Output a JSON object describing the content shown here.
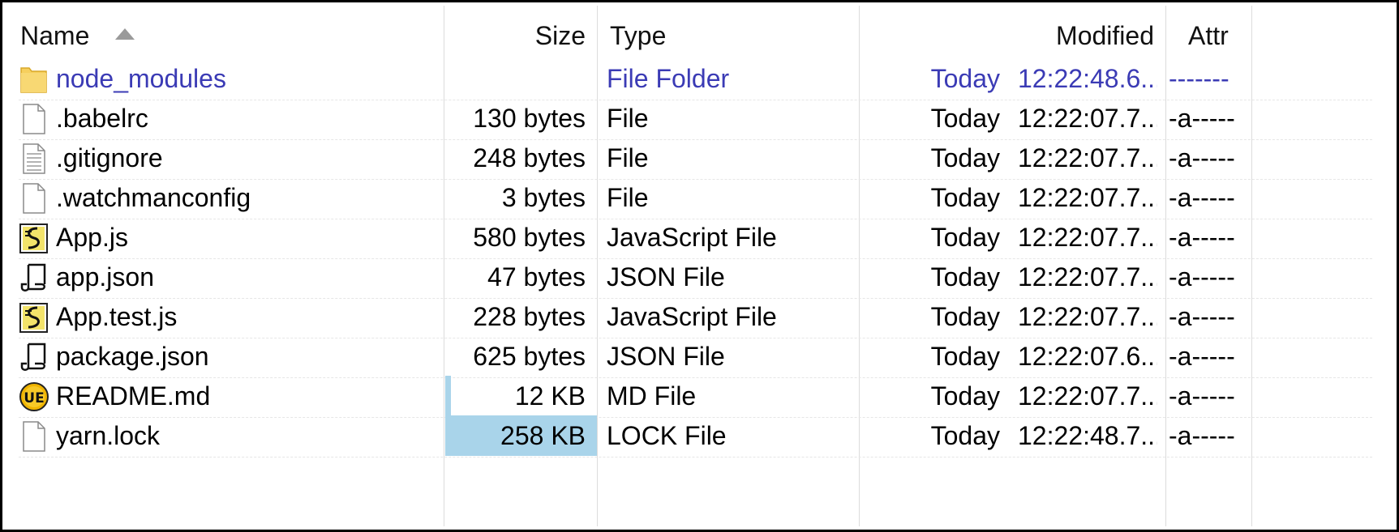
{
  "columns": {
    "name": "Name",
    "size": "Size",
    "type": "Type",
    "modified": "Modified",
    "attr": "Attr"
  },
  "sort": {
    "column": "name",
    "direction": "ascending"
  },
  "colors": {
    "folder_text": "#3b3bb5",
    "size_bar": "#a9d4ea",
    "folder_icon": "#f6cf5e"
  },
  "files": [
    {
      "name": "node_modules",
      "size": "",
      "type": "File Folder",
      "date": "Today",
      "time": "12:22:48.6...",
      "attr": "-------",
      "icon": "folder-icon",
      "size_fraction": 0
    },
    {
      "name": ".babelrc",
      "size": "130 bytes",
      "type": "File",
      "date": "Today",
      "time": "12:22:07.7...",
      "attr": "-a-----",
      "icon": "blank-file-icon",
      "size_fraction": 0
    },
    {
      "name": ".gitignore",
      "size": "248 bytes",
      "type": "File",
      "date": "Today",
      "time": "12:22:07.7...",
      "attr": "-a-----",
      "icon": "text-file-icon",
      "size_fraction": 0
    },
    {
      "name": ".watchmanconfig",
      "size": "3 bytes",
      "type": "File",
      "date": "Today",
      "time": "12:22:07.7...",
      "attr": "-a-----",
      "icon": "blank-file-icon",
      "size_fraction": 0
    },
    {
      "name": "App.js",
      "size": "580 bytes",
      "type": "JavaScript File",
      "date": "Today",
      "time": "12:22:07.7...",
      "attr": "-a-----",
      "icon": "script-file-icon",
      "size_fraction": 0
    },
    {
      "name": "app.json",
      "size": "47 bytes",
      "type": "JSON File",
      "date": "Today",
      "time": "12:22:07.7...",
      "attr": "-a-----",
      "icon": "scroll-file-icon",
      "size_fraction": 0
    },
    {
      "name": "App.test.js",
      "size": "228 bytes",
      "type": "JavaScript File",
      "date": "Today",
      "time": "12:22:07.7...",
      "attr": "-a-----",
      "icon": "script-file-icon",
      "size_fraction": 0
    },
    {
      "name": "package.json",
      "size": "625 bytes",
      "type": "JSON File",
      "date": "Today",
      "time": "12:22:07.6...",
      "attr": "-a-----",
      "icon": "scroll-file-icon",
      "size_fraction": 0
    },
    {
      "name": "README.md",
      "size": "12 KB",
      "type": "MD File",
      "date": "Today",
      "time": "12:22:07.7...",
      "attr": "-a-----",
      "icon": "ultraedit-icon",
      "size_fraction": 0.04
    },
    {
      "name": "yarn.lock",
      "size": "258 KB",
      "type": "LOCK File",
      "date": "Today",
      "time": "12:22:48.7...",
      "attr": "-a-----",
      "icon": "blank-file-icon",
      "size_fraction": 1
    }
  ]
}
